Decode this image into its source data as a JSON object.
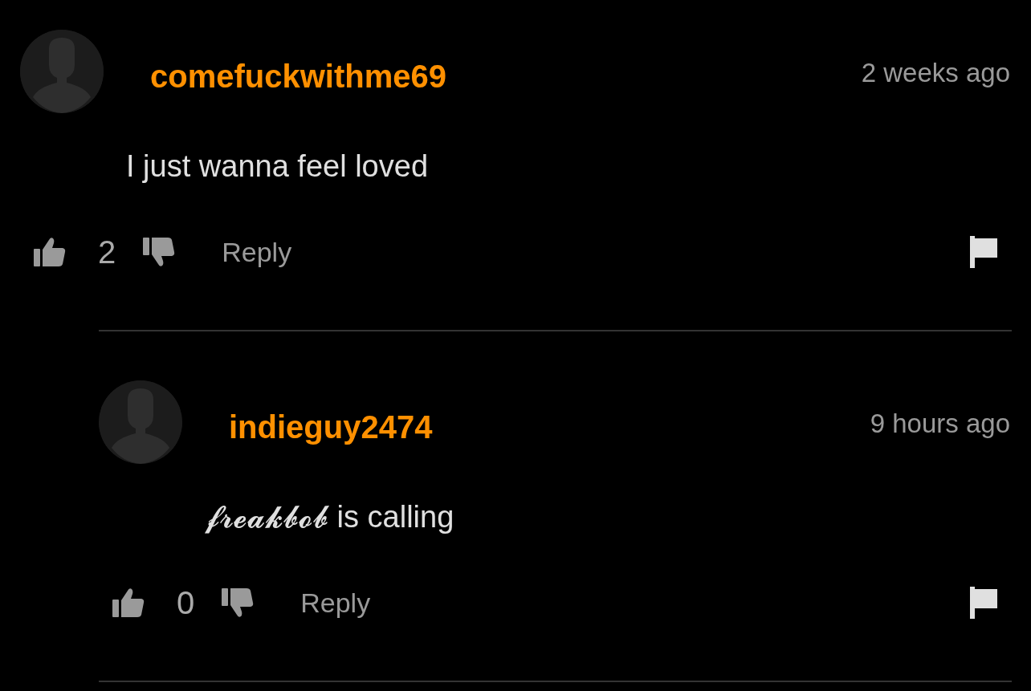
{
  "comments": [
    {
      "username": "comefuckwithme69",
      "time": "2 weeks ago",
      "text": "I just wanna feel loved",
      "likes": "2",
      "reply": "Reply",
      "children": [
        {
          "username": "indieguy2474",
          "time": "9 hours ago",
          "text": "𝓯𝓻𝓮𝓪𝓴𝓫𝓸𝓫 is calling",
          "likes": "0",
          "reply": "Reply"
        }
      ]
    }
  ]
}
